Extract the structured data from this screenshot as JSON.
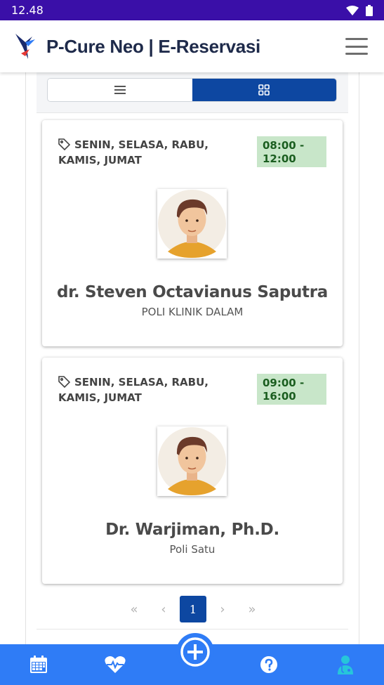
{
  "status_bar": {
    "time": "12.48"
  },
  "app_bar": {
    "title": "P-Cure Neo | E-Reservasi"
  },
  "view_toggle": {
    "active": "grid"
  },
  "doctors": [
    {
      "days": "SENIN, SELASA, RABU, KAMIS, JUMAT",
      "time": "08:00 - 12:00",
      "name": "dr. Steven Octavianus Saputra",
      "poli": "POLI KLINIK DALAM"
    },
    {
      "days": "SENIN, SELASA, RABU, KAMIS, JUMAT",
      "time": "09:00 - 16:00",
      "name": "Dr. Warjiman, Ph.D.",
      "poli": "Poli Satu"
    }
  ],
  "pagination": {
    "first": "«",
    "prev": "‹",
    "current": "1",
    "next": "›",
    "last": "»"
  },
  "bottom_nav": {
    "items": [
      "calendar-icon",
      "heartbeat-icon",
      "add-icon",
      "help-icon",
      "doctor-icon"
    ]
  },
  "colors": {
    "status_bar": "#3a0fa8",
    "primary": "#0d47a1",
    "nav": "#2f7cf6",
    "badge_bg": "#c8e6c9",
    "badge_text": "#1b5e20"
  }
}
